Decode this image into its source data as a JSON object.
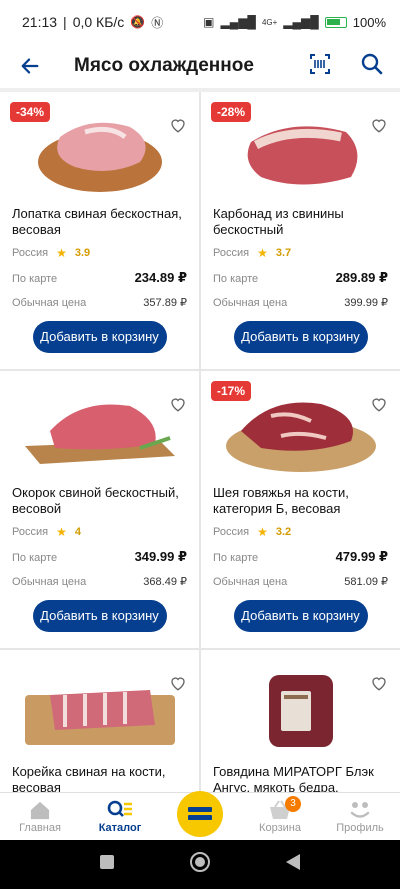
{
  "status": {
    "time": "21:13",
    "net_speed": "0,0 КБ/с",
    "signal_label": "4G+",
    "battery": "100%"
  },
  "header": {
    "title": "Мясо охлажденное"
  },
  "products": [
    {
      "badge": "-34%",
      "name": "Лопатка свиная бескостная, весовая",
      "country": "Россия",
      "rating": "3.9",
      "card_label": "По карте",
      "card_price": "234.89 ₽",
      "regular_label": "Обычная цена",
      "regular_price": "357.89 ₽",
      "add_label": "Добавить в корзину"
    },
    {
      "badge": "-28%",
      "name": "Карбонад из свинины бескостный крупнокусковой…",
      "country": "Россия",
      "rating": "3.7",
      "card_label": "По карте",
      "card_price": "289.89 ₽",
      "regular_label": "Обычная цена",
      "regular_price": "399.99 ₽",
      "add_label": "Добавить в корзину"
    },
    {
      "badge": "",
      "name": "Окорок свиной бескостный, весовой",
      "country": "Россия",
      "rating": "4",
      "card_label": "По карте",
      "card_price": "349.99 ₽",
      "regular_label": "Обычная цена",
      "regular_price": "368.49 ₽",
      "add_label": "Добавить в корзину"
    },
    {
      "badge": "-17%",
      "name": "Шея говяжья на кости, категория Б, весовая",
      "country": "Россия",
      "rating": "3.2",
      "card_label": "По карте",
      "card_price": "479.99 ₽",
      "regular_label": "Обычная цена",
      "regular_price": "581.09 ₽",
      "add_label": "Добавить в корзину"
    },
    {
      "badge": "",
      "name": "Корейка свиная на кости, весовая"
    },
    {
      "badge": "",
      "name": "Говядина МИРАТОРГ Блэк Ангус, мякоть бедра, бескос…"
    }
  ],
  "bottom_nav": {
    "home": "Главная",
    "catalog": "Каталог",
    "cart": "Корзина",
    "cart_count": "3",
    "profile": "Профиль"
  },
  "colors": {
    "primary": "#063f8f",
    "badge": "#e53935",
    "star": "#f5b301",
    "center_button": "#f7c700"
  }
}
